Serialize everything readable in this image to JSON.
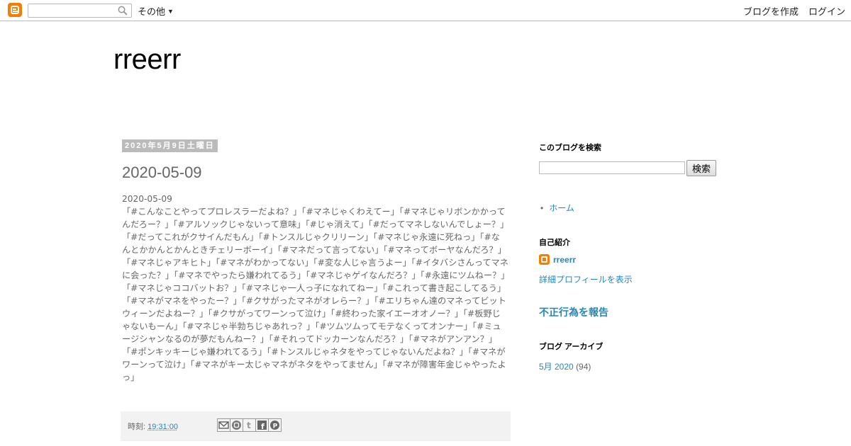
{
  "navbar": {
    "search_placeholder": "",
    "more_label": "その他",
    "create_blog_label": "ブログを作成",
    "login_label": "ログイン"
  },
  "blog": {
    "title": "rreerr"
  },
  "post": {
    "date_header": "2020年5月9日土曜日",
    "title": "2020-05-09",
    "body_first_line": "2020-05-09",
    "body_text": "「#こんなことやってプロレスラーだよね？」「#マネじゃくわえてー」「#マネじゃリボンかかってんだろー？」「#アルソックじゃないって意味」「#じゃ消えて」「#だってマネしないんでしょー？」「#だってこれがクサイんだもん」「#トンスルじゃクリリーン」「#マネじゃ永遠に死ねっ」「#なんとかかんとかんときチェリーボーイ」「#マネだって言ってない」「#マネってボーヤなんだろ？」「#マネじゃアキヒト」「#マネがわかってない」「#変な人じゃ言うよー」「#イタバシさんってマネに会った？」「#マネでやったら嫌われてるう」「#マネじゃゲイなんだろ？」「#永遠にツムねー？」「#マネじゃココバットお？」「#マネじゃ一人っ子になれてねー」「#これって書き起こしてるう」「#マネがマネをやったー？」「#クサがったマネがオレらー？」「#エリちゃん達のマネってビットウィーンだよねー？」「#クサがってワーンって泣け」「#終わった家イエーオオノー？」「#板野じゃないもーん」「#マネじゃ半勃ちじゃあれっ？」「#ツムツムってモテなくってオンナー」「#ミュージシャンなるのが夢だもんねー？」「#それってドッカーンなんだろ？」「#マネがアンアン？」「#ポンキッキーじゃ嫌われてるう」「#トンスルじゃネタをやってじゃないんだよね？」「#マネがワーンって泣け」「#マネがキー太じゃマネがネタをやってません」「#マネが障害年金じゃやったよっ」",
    "footer": {
      "posted_at_label": "時刻:",
      "time": "19:31:00"
    },
    "share_icons": [
      "email-icon",
      "blogger-icon",
      "twitter-icon",
      "facebook-icon",
      "pinterest-icon"
    ]
  },
  "sidebar": {
    "search": {
      "title": "このブログを検索",
      "button_label": "検索"
    },
    "pages": [
      {
        "label": "ホーム"
      }
    ],
    "profile": {
      "title": "自己紹介",
      "name": "rreerr",
      "view_profile_label": "詳細プロフィールを表示"
    },
    "report_abuse_label": "不正行為を報告",
    "archive": {
      "title": "ブログ アーカイブ",
      "month_label": "5月 2020",
      "count": "(94)"
    }
  },
  "colors": {
    "brand": "#f57d00",
    "link": "#2288bb",
    "text": "#666666",
    "date_header_bg": "#bbbbbb"
  }
}
